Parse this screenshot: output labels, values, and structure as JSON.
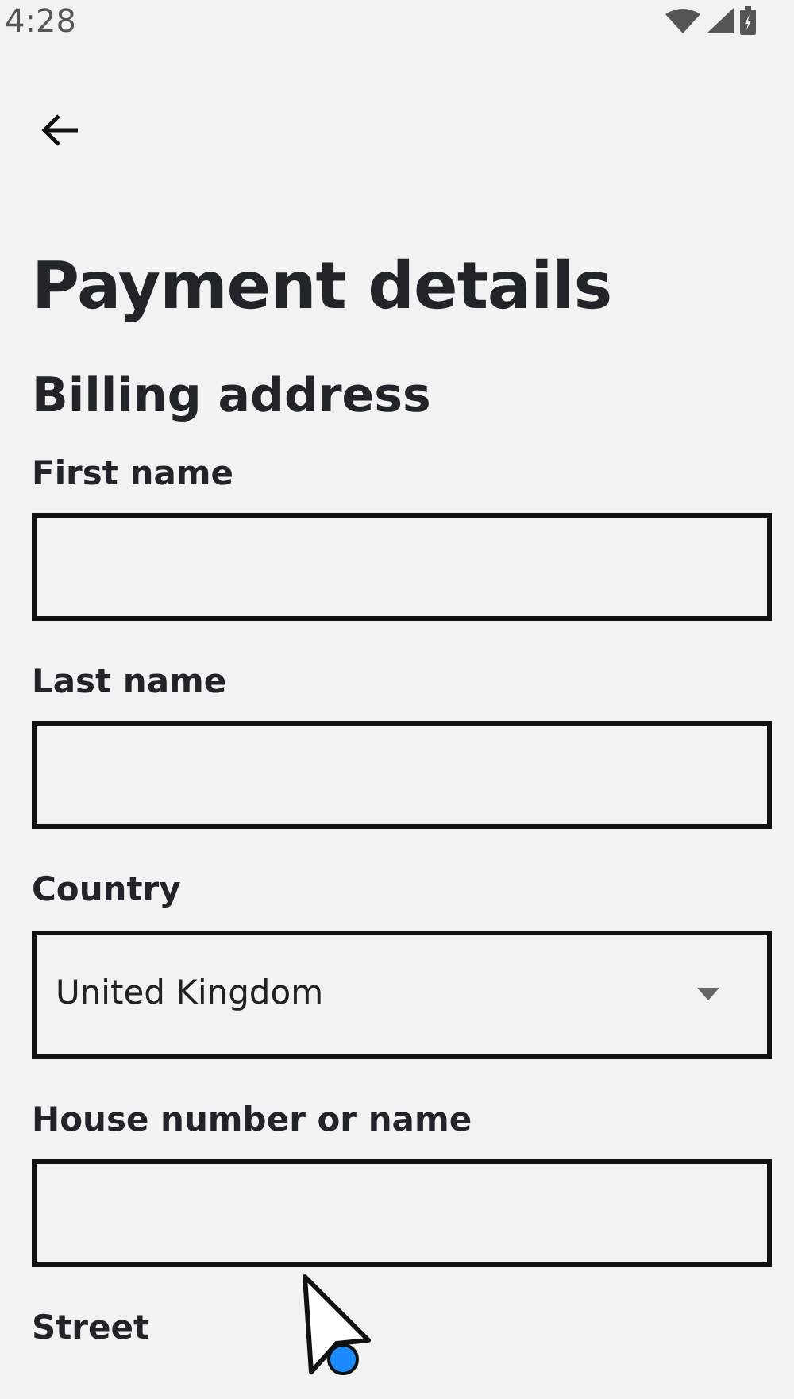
{
  "status_bar": {
    "time": "4:28"
  },
  "title": "Payment details",
  "section": "Billing address",
  "fields": [
    {
      "kind": "text",
      "label": "First name"
    },
    {
      "kind": "text",
      "label": "Last name"
    },
    {
      "kind": "select",
      "label": "Country",
      "value": "United Kingdom"
    },
    {
      "kind": "text",
      "label": "House number or name"
    },
    {
      "kind": "label",
      "label": "Street"
    }
  ]
}
